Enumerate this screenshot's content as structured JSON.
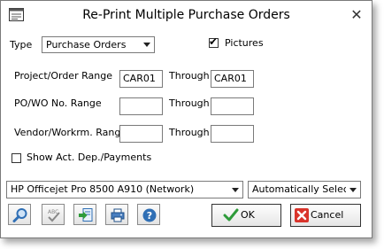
{
  "window": {
    "title": "Re-Print Multiple Purchase Orders"
  },
  "form": {
    "type_label": "Type",
    "type_value": "Purchase Orders",
    "pictures_label": "Pictures",
    "pictures_checked": true,
    "project_range_label": "Project/Order Range",
    "project_from": "CAR01",
    "project_through_label": "Through",
    "project_to": "CAR01",
    "powo_range_label": "PO/WO No. Range",
    "powo_from": "",
    "powo_through_label": "Through",
    "powo_to": "",
    "vendor_range_label": "Vendor/Workrm. Range",
    "vendor_from": "",
    "vendor_through_label": "Through",
    "vendor_to": "",
    "show_payments_label": "Show Act. Dep./Payments",
    "show_payments_checked": false
  },
  "printer": {
    "name": "HP Officejet Pro 8500 A910 (Network)",
    "tray": "Automatically Select"
  },
  "toolbar": {
    "icons": [
      "preview-icon",
      "spell-check-icon",
      "export-icon",
      "printer-setup-icon",
      "help-icon"
    ]
  },
  "buttons": {
    "ok_label": "OK",
    "cancel_label": "Cancel"
  },
  "colors": {
    "ok_check": "#2e9b3a",
    "cancel_x": "#d9342b",
    "icon_blue": "#2f6fb5"
  }
}
